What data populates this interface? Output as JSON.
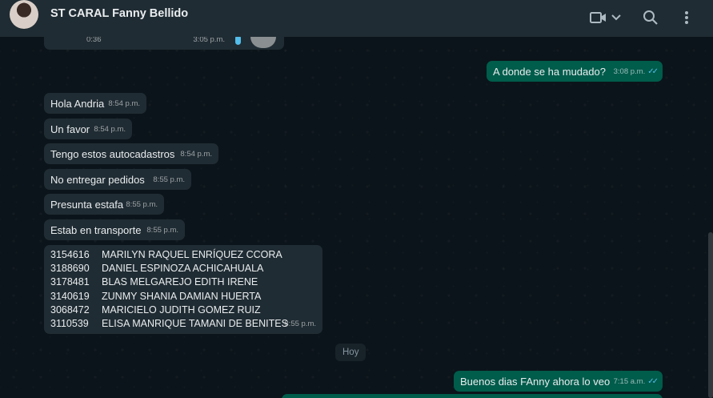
{
  "header": {
    "contact_name": "ST CARAL Fanny Bellido"
  },
  "icons": {
    "video": "video-call-icon",
    "chevron": "chevron-down-icon",
    "search": "search-icon",
    "menu": "menu-dots-icon"
  },
  "colors": {
    "header_bg": "#202c33",
    "chat_bg": "#0b141a",
    "incoming": "#202c33",
    "outgoing": "#005c4b",
    "read_check": "#53bdeb"
  },
  "messages": [
    {
      "id": "audio",
      "duration": "0:36",
      "time": "3:05 p.m."
    },
    {
      "id": "m1",
      "text": "A donde se ha mudado?",
      "time": "3:08 p.m."
    },
    {
      "id": "m2",
      "text": "Hola Andria",
      "time": "8:54 p.m."
    },
    {
      "id": "m3",
      "text": "Un favor",
      "time": "8:54 p.m."
    },
    {
      "id": "m4",
      "text": "Tengo estos autocadastros",
      "time": "8:54 p.m."
    },
    {
      "id": "m5",
      "text": "No entregar pedidos",
      "time": "8:55 p.m."
    },
    {
      "id": "m6",
      "text": "Presunta estafa",
      "time": "8:55 p.m."
    },
    {
      "id": "m7",
      "text": "Estab en transporte",
      "time": "8:55 p.m."
    },
    {
      "id": "m8",
      "time": "8:55 p.m."
    },
    {
      "id": "m9",
      "text": "Buenos dias FAnny ahora lo veo",
      "time": "7:15 a.m."
    }
  ],
  "table_rows": [
    {
      "code": "3154616",
      "name": "MARILYN RAQUEL ENRÍQUEZ CCORA"
    },
    {
      "code": "3188690",
      "name": "DANIEL ESPINOZA ACHICAHUALA"
    },
    {
      "code": "3178481",
      "name": "BLAS MELGAREJO EDITH IRENE"
    },
    {
      "code": "3140619",
      "name": "ZUNMY SHANIA DAMIAN HUERTA"
    },
    {
      "code": "3068472",
      "name": "MARICIELO JUDITH GOMEZ RUIZ"
    },
    {
      "code": "3110539",
      "name": "ELISA MANRIQUE TAMANI DE BENITES"
    }
  ],
  "day_separator": "Hoy"
}
